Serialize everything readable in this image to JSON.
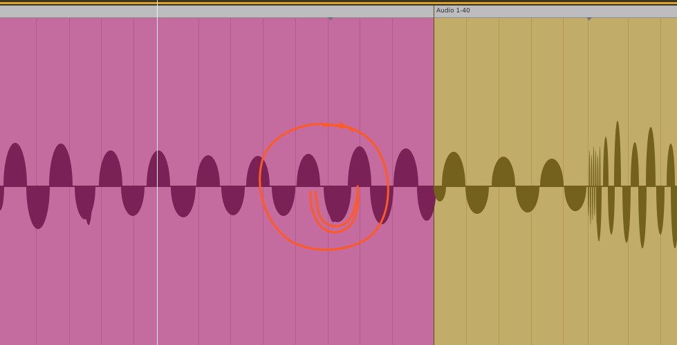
{
  "arrangement": {
    "clips": [
      {
        "title": "",
        "color": "#c46ba0",
        "wave_color": "#7a2158"
      },
      {
        "title": "Audio 1-40",
        "color": "#c2ac6a",
        "wave_color": "#74611e"
      }
    ]
  },
  "annotation": {
    "shape": "hand-drawn circle",
    "color": "#ff5a1f"
  }
}
